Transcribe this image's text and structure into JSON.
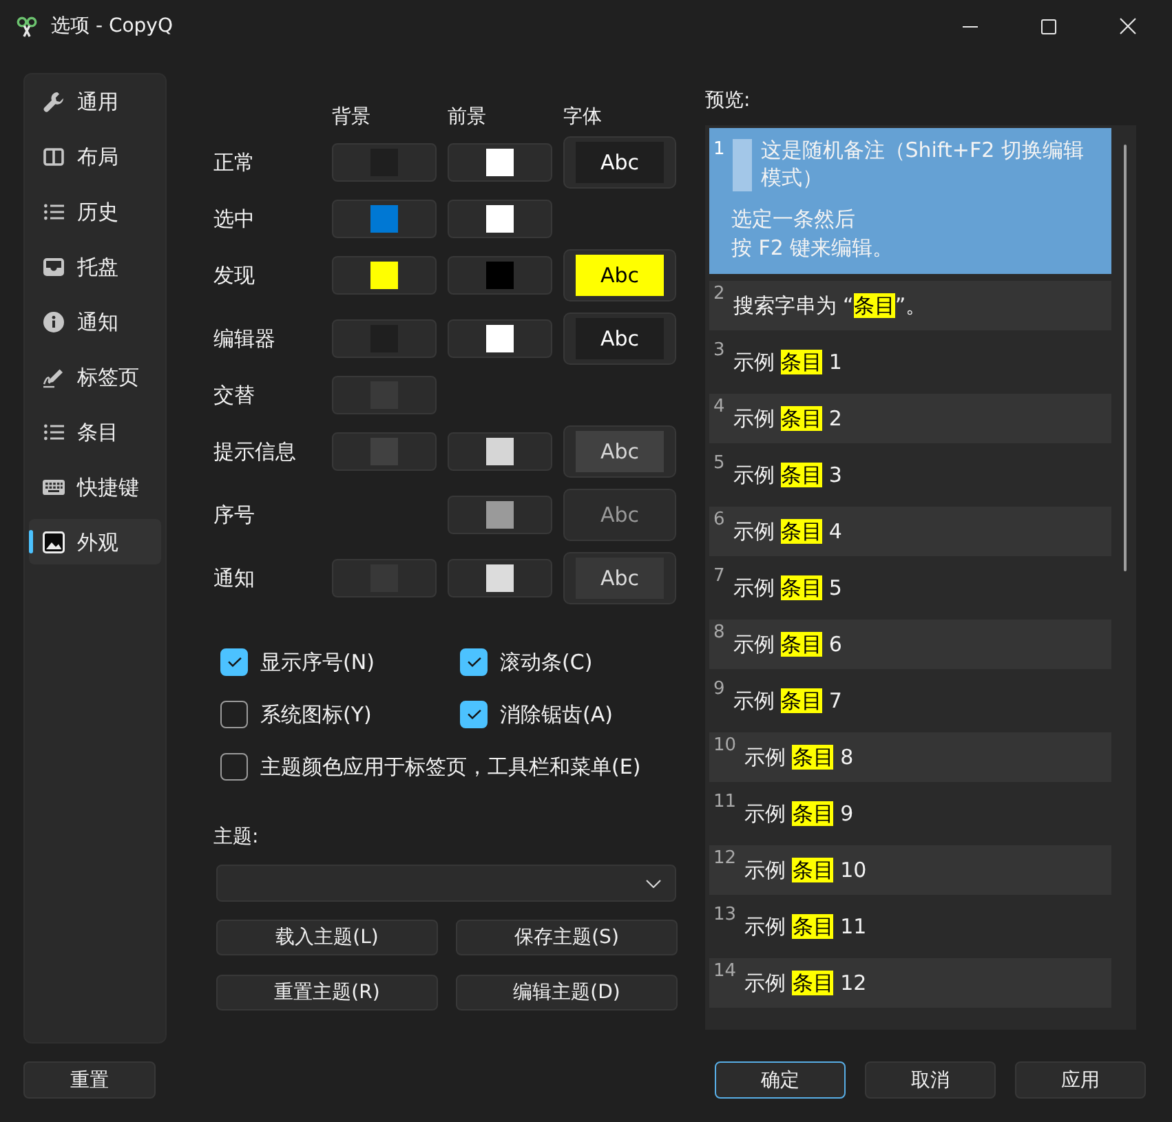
{
  "window": {
    "title": "选项 - CopyQ"
  },
  "sidebar": {
    "items": [
      {
        "label": "通用",
        "selected": false
      },
      {
        "label": "布局",
        "selected": false
      },
      {
        "label": "历史",
        "selected": false
      },
      {
        "label": "托盘",
        "selected": false
      },
      {
        "label": "通知",
        "selected": false
      },
      {
        "label": "标签页",
        "selected": false
      },
      {
        "label": "条目",
        "selected": false
      },
      {
        "label": "快捷键",
        "selected": false
      },
      {
        "label": "外观",
        "selected": true
      }
    ]
  },
  "colors": {
    "columns": [
      "背景",
      "前景",
      "字体"
    ],
    "rows": [
      {
        "label": "正常",
        "background": {
          "color": "#1f1f1f"
        },
        "foreground": {
          "color": "#ffffff"
        },
        "font": {
          "label": "Abc"
        }
      },
      {
        "label": "选中",
        "background": {
          "color": "#0078d4"
        },
        "foreground": {
          "color": "#ffffff"
        }
      },
      {
        "label": "发现",
        "background": {
          "color": "#ffff00"
        },
        "foreground": {
          "color": "#000000"
        },
        "font": {
          "label": "Abc"
        }
      },
      {
        "label": "编辑器",
        "background": {
          "color": "#1f1f1f"
        },
        "foreground": {
          "color": "#ffffff"
        },
        "font": {
          "label": "Abc"
        }
      },
      {
        "label": "交替",
        "background": {
          "color": "#3a3a3a"
        }
      },
      {
        "label": "提示信息",
        "background": {
          "color": "#414141"
        },
        "foreground": {
          "color": "#d6d6d6"
        },
        "font": {
          "label": "Abc"
        }
      },
      {
        "label": "序号",
        "foreground": {
          "color": "#9a9a9a"
        },
        "font": {
          "label": "Abc"
        }
      },
      {
        "label": "通知",
        "background": {
          "color": "#383838"
        },
        "foreground": {
          "color": "#dcdcdc"
        },
        "font": {
          "label": "Abc"
        }
      }
    ]
  },
  "options": [
    {
      "label": "显示序号(N)",
      "checked": true
    },
    {
      "label": "滚动条(C)",
      "checked": true
    },
    {
      "label": "系统图标(Y)",
      "checked": false
    },
    {
      "label": "消除锯齿(A)",
      "checked": true
    },
    {
      "label": "主题颜色应用于标签页，工具栏和菜单(E)",
      "checked": false
    }
  ],
  "theme": {
    "label": "主题:",
    "buttons": [
      "载入主题(L)",
      "保存主题(S)",
      "重置主题(R)",
      "编辑主题(D)"
    ]
  },
  "preview": {
    "label": "预览:",
    "items": [
      {
        "kind": "note",
        "number": "1",
        "selected": true,
        "note": "这是随机备注（Shift+F2 切换编辑模式）",
        "lines": [
          "选定一条然后",
          "按 F2 键来编辑。"
        ]
      },
      {
        "kind": "match",
        "number": "2",
        "selected": false,
        "before": "搜索字串为 “",
        "match": "条目",
        "after": "”。"
      },
      {
        "kind": "match",
        "number": "3",
        "selected": false,
        "before": "示例 ",
        "match": "条目",
        "after": " 1"
      },
      {
        "kind": "match",
        "number": "4",
        "selected": false,
        "before": "示例 ",
        "match": "条目",
        "after": " 2"
      },
      {
        "kind": "match",
        "number": "5",
        "selected": false,
        "before": "示例 ",
        "match": "条目",
        "after": " 3"
      },
      {
        "kind": "match",
        "number": "6",
        "selected": false,
        "before": "示例 ",
        "match": "条目",
        "after": " 4"
      },
      {
        "kind": "match",
        "number": "7",
        "selected": false,
        "before": "示例 ",
        "match": "条目",
        "after": " 5"
      },
      {
        "kind": "match",
        "number": "8",
        "selected": false,
        "before": "示例 ",
        "match": "条目",
        "after": " 6"
      },
      {
        "kind": "match",
        "number": "9",
        "selected": false,
        "before": "示例 ",
        "match": "条目",
        "after": " 7"
      },
      {
        "kind": "match",
        "number": "10",
        "selected": false,
        "before": "示例 ",
        "match": "条目",
        "after": " 8"
      },
      {
        "kind": "match",
        "number": "11",
        "selected": false,
        "before": "示例 ",
        "match": "条目",
        "after": " 9"
      },
      {
        "kind": "match",
        "number": "12",
        "selected": false,
        "before": "示例 ",
        "match": "条目",
        "after": " 10"
      },
      {
        "kind": "match",
        "number": "13",
        "selected": false,
        "before": "示例 ",
        "match": "条目",
        "after": " 11"
      },
      {
        "kind": "match",
        "number": "14",
        "selected": false,
        "before": "示例 ",
        "match": "条目",
        "after": " 12"
      }
    ]
  },
  "footer": {
    "left": [
      {
        "label": "重置",
        "default": false
      }
    ],
    "right": [
      {
        "label": "确定",
        "default": true
      },
      {
        "label": "取消",
        "default": false
      },
      {
        "label": "应用",
        "default": false
      }
    ]
  }
}
